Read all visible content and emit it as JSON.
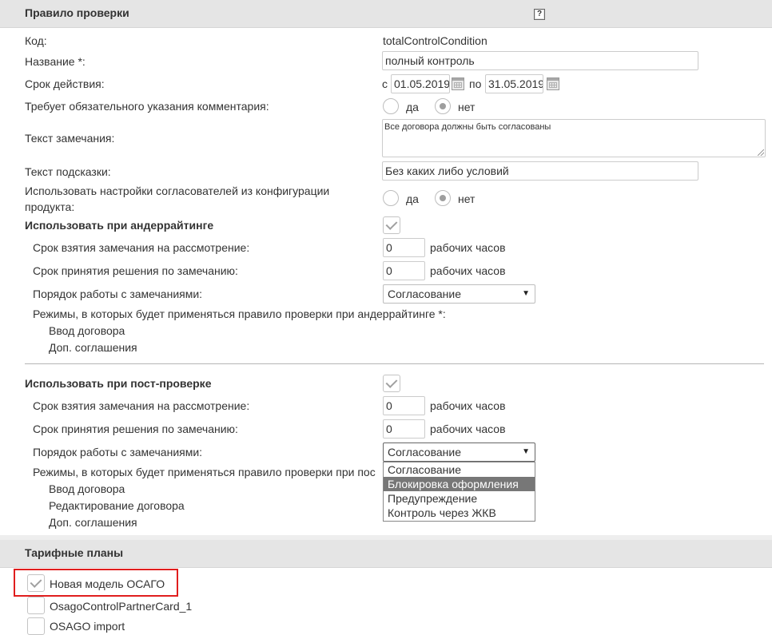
{
  "rule_section": {
    "title": "Правило проверки",
    "help_label": "?",
    "code_label": "Код:",
    "code_value": "totalControlCondition",
    "name_label": "Название *:",
    "name_value": "полный контроль",
    "validity_label": "Срок действия:",
    "validity_from_prefix": "с",
    "validity_from": "01.05.2019",
    "validity_to_prefix": "по",
    "validity_to": "31.05.2019",
    "requires_comment_label": "Требует обязательного указания комментария:",
    "requires_comment_yes": "да",
    "requires_comment_no": "нет",
    "remark_text_label": "Текст замечания:",
    "remark_text_value": "Все договора должны быть согласованы",
    "hint_text_label": "Текст подсказки:",
    "hint_text_value": "Без каких либо условий",
    "use_approvers_label_line1": "Использовать настройки согласователей из конфигурации",
    "use_approvers_label_line2": "продукта:",
    "use_approvers_yes": "да",
    "use_approvers_no": "нет"
  },
  "underwriting": {
    "title": "Использовать при андеррайтинге",
    "checked": true,
    "take_time_label": "Срок взятия замечания на рассмотрение:",
    "take_time_value": "0",
    "take_time_unit": "рабочих часов",
    "decision_time_label": "Срок принятия решения по замечанию:",
    "decision_time_value": "0",
    "decision_time_unit": "рабочих часов",
    "order_label": "Порядок работы с замечаниями:",
    "order_value": "Согласование",
    "order_arrow": "▼",
    "modes_label": "Режимы, в которых будет применяться правило проверки при андеррайтинге *:",
    "modes": [
      "Ввод договора",
      "Доп. соглашения"
    ]
  },
  "post_check": {
    "title": "Использовать при пост-проверке",
    "checked": true,
    "take_time_label": "Срок взятия замечания на рассмотрение:",
    "take_time_value": "0",
    "take_time_unit": "рабочих часов",
    "decision_time_label": "Срок принятия решения по замечанию:",
    "decision_time_value": "0",
    "decision_time_unit": "рабочих часов",
    "order_label": "Порядок работы с замечаниями:",
    "order_value": "Согласование",
    "order_arrow": "▼",
    "order_options": [
      "Согласование",
      "Блокировка оформления",
      "Предупреждение",
      "Контроль через ЖКВ"
    ],
    "order_highlighted": "Блокировка оформления",
    "modes_label": "Режимы, в которых будет применяться правило проверки при пос",
    "modes": [
      "Ввод договора",
      "Редактирование договора",
      "Доп. соглашения"
    ]
  },
  "tariff_section": {
    "title": "Тарифные планы",
    "plans": [
      {
        "label": "Новая модель ОСАГО",
        "checked": true
      },
      {
        "label": "OsagoControlPartnerCard_1",
        "checked": false
      },
      {
        "label": "OSAGO import",
        "checked": false
      }
    ]
  },
  "colors": {
    "header_bg": "#e5e5e5",
    "highlight_border": "#e01e1e",
    "selected_option_bg": "#777777"
  }
}
